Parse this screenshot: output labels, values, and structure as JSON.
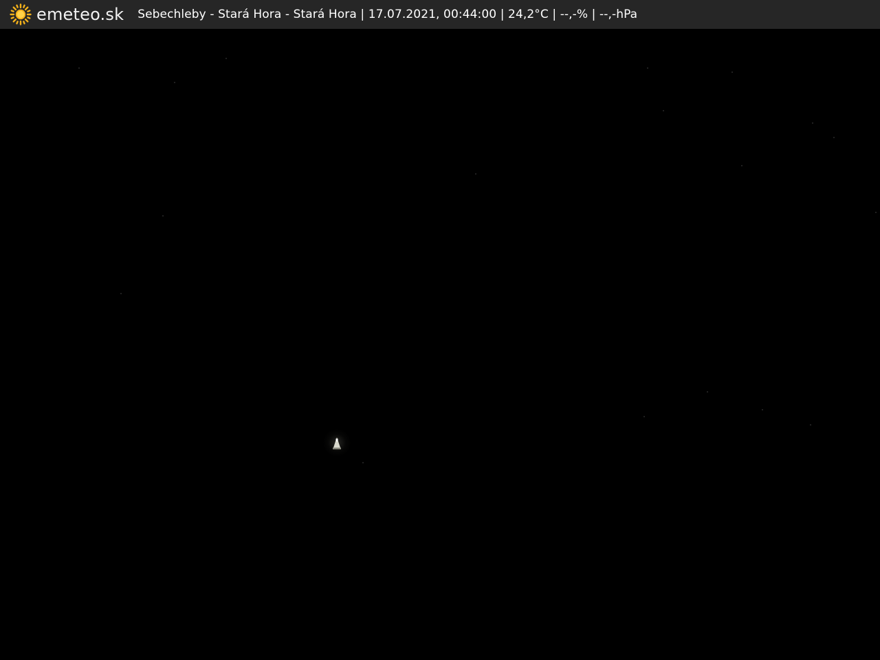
{
  "header": {
    "brand": "emeteo.sk",
    "icon": "sun-icon",
    "caption": "Sebechleby - Stará Hora - Stará Hora | 17.07.2021, 00:44:00 | 24,2°C | --,-% | --,-hPa"
  },
  "colors": {
    "bar_background": "#262626",
    "sun": "#f5b21a",
    "text": "#ffffff",
    "camera_background": "#000000"
  }
}
